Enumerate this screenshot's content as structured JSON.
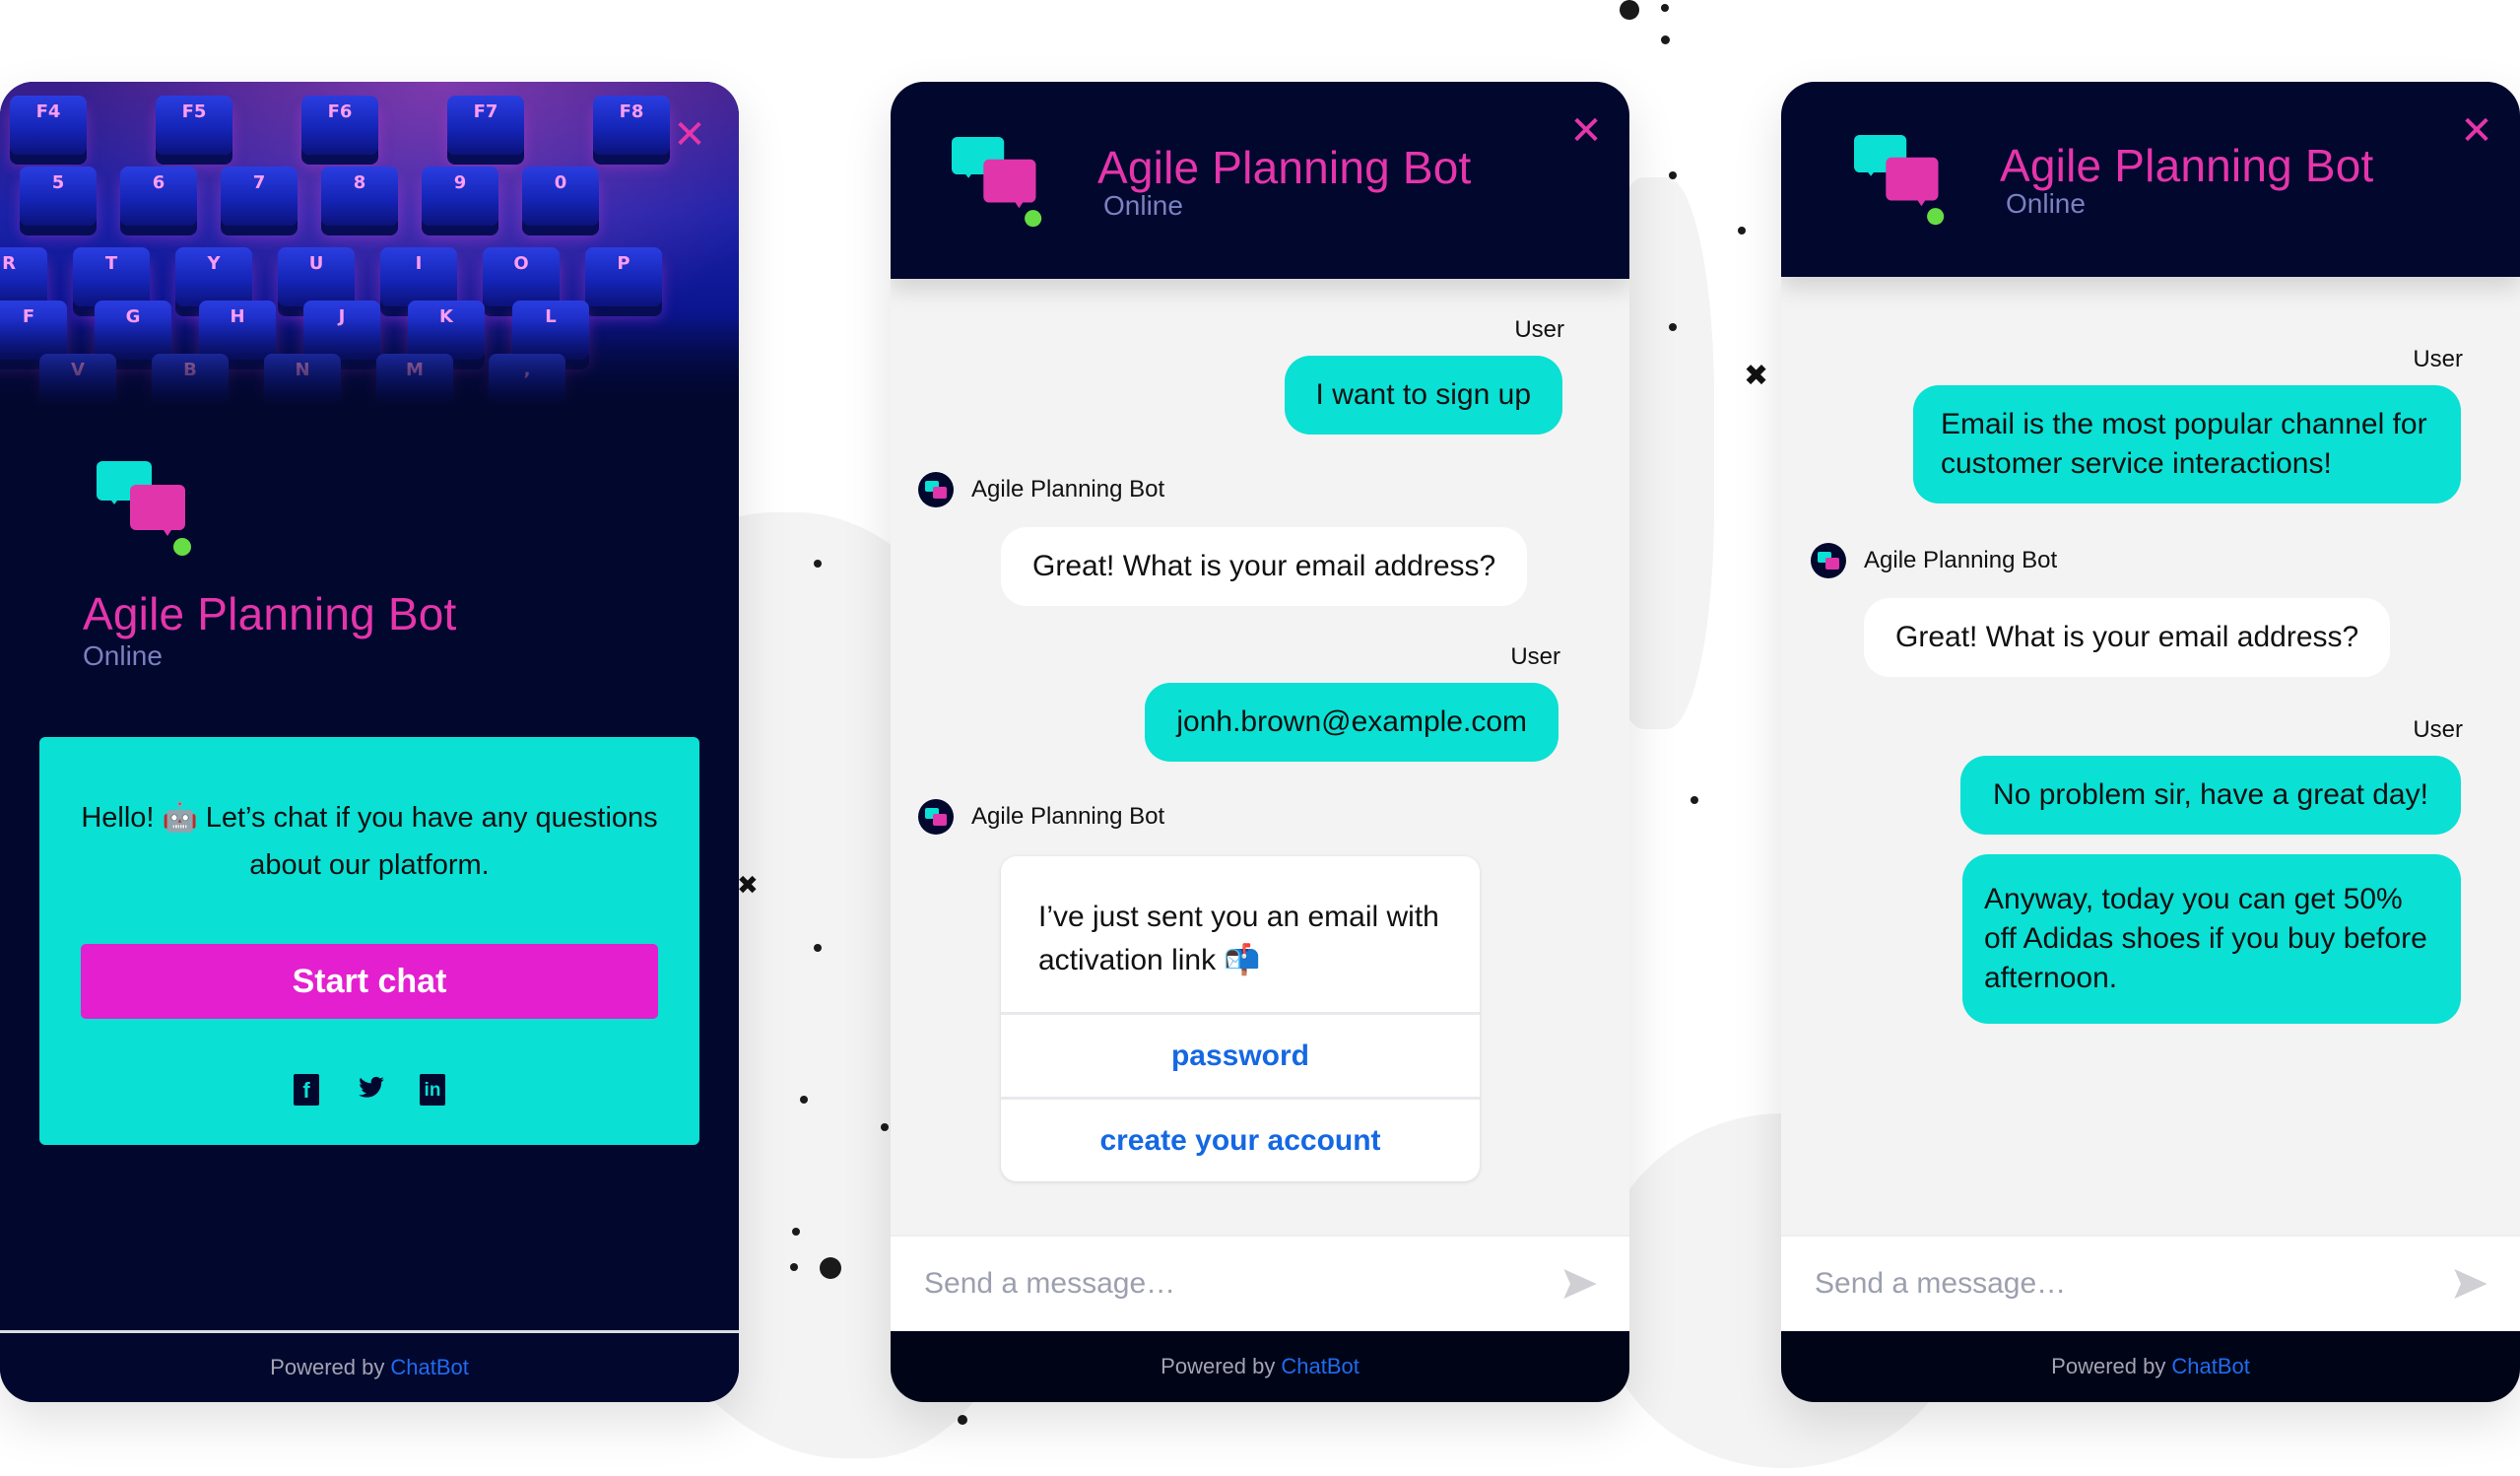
{
  "bot": {
    "name": "Agile Planning Bot",
    "status": "Online"
  },
  "colors": {
    "navy": "#02072e",
    "teal": "#0ae0d4",
    "magenta": "#e535ab",
    "start_button": "#e31fd0",
    "online_dot": "#66dd44",
    "link_blue": "#1468e3"
  },
  "icons": {
    "close": "✕",
    "facebook": "f",
    "twitter": "🐦",
    "linkedin": "in",
    "send": "send-arrow"
  },
  "welcome": {
    "hero_keys_row1": [
      "F4",
      "F5",
      "F6",
      "F7",
      "F8"
    ],
    "hero_keys_row2": [
      "5",
      "6",
      "7",
      "8",
      "9",
      "0"
    ],
    "hero_keys_row3": [
      "R",
      "T",
      "Y",
      "U",
      "I",
      "O",
      "P"
    ],
    "hero_keys_row4": [
      "F",
      "G",
      "H",
      "J",
      "K",
      "L"
    ],
    "hero_keys_row5": [
      "V",
      "B",
      "N",
      "M",
      ","
    ],
    "message": "Hello! 🤖 Let’s chat if you have any questions about our platform.",
    "start_button": "Start chat",
    "powered_by": "Powered by",
    "brand": "ChatBot"
  },
  "chat_middle": {
    "messages": [
      {
        "author": "User",
        "text": "I want to sign up"
      },
      {
        "author": "Agile Planning Bot",
        "text": "Great! What is your email address?"
      },
      {
        "author": "User",
        "text": "jonh.brown@example.com"
      },
      {
        "author": "Agile Planning Bot",
        "text": "I’ve just sent you an email with activation link 📬",
        "buttons": [
          "password",
          "create your account"
        ]
      }
    ],
    "composer_placeholder": "Send a message…",
    "powered_by": "Powered by",
    "brand": "ChatBot"
  },
  "chat_right": {
    "messages": [
      {
        "author": "User",
        "text": "Email is the most popular channel for customer service interactions!"
      },
      {
        "author": "Agile Planning Bot",
        "text": "Great! What is your email address?"
      },
      {
        "author": "User",
        "text": "No problem sir, have a great day!"
      },
      {
        "author": "User",
        "text": "Anyway, today you can get 50% off Adidas shoes if you buy before afternoon."
      }
    ],
    "composer_placeholder": "Send a message…",
    "powered_by": "Powered by",
    "brand": "ChatBot"
  }
}
